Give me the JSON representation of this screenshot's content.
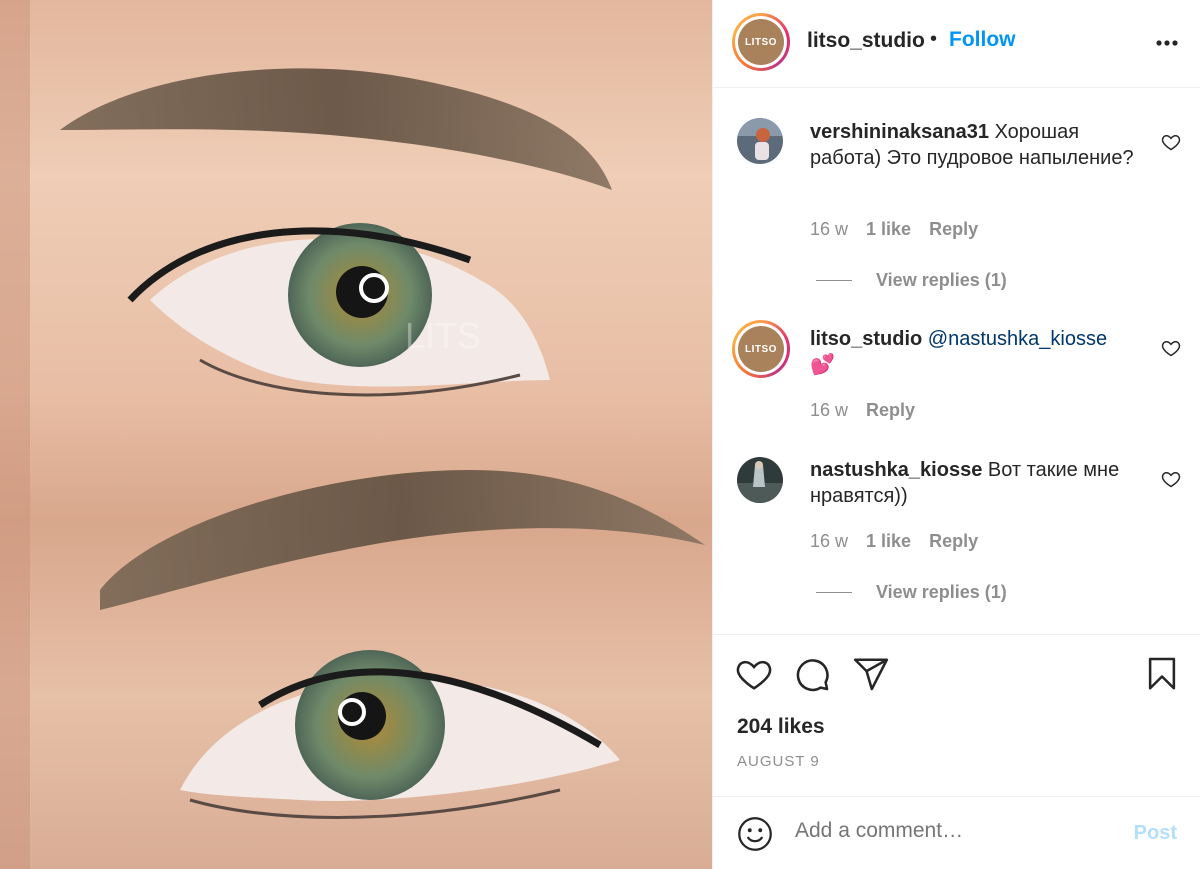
{
  "post": {
    "image_watermark": "LITS",
    "author": {
      "username": "litso_studio",
      "avatar_text": "LITSO",
      "follow_label": "Follow",
      "separator": "•"
    }
  },
  "comments": [
    {
      "username": "vershininaksana31",
      "text": "Хорошая работа) Это пудровое напыление?",
      "time": "16 w",
      "likes": "1 like",
      "reply_label": "Reply",
      "view_replies": "View replies (1)"
    },
    {
      "username": "litso_studio",
      "avatar_text": "LITSO",
      "mention": "@nastushka_kiosse",
      "text": "💕",
      "time": "16 w",
      "reply_label": "Reply"
    },
    {
      "username": "nastushka_kiosse",
      "text": "Вот такие мне нравятся))",
      "time": "16 w",
      "likes": "1 like",
      "reply_label": "Reply",
      "view_replies": "View replies (1)"
    }
  ],
  "actions": {
    "icons": [
      "heart-icon",
      "comment-icon",
      "share-icon",
      "bookmark-icon"
    ],
    "likes": "204 likes",
    "date": "AUGUST 9"
  },
  "add_comment": {
    "placeholder": "Add a comment…",
    "post_label": "Post"
  },
  "colors": {
    "accent": "#0095f6",
    "mention": "#00376b",
    "muted": "#8e8e8e",
    "post_disabled": "#b2dffc",
    "avatar_brown": "#a9825b"
  }
}
